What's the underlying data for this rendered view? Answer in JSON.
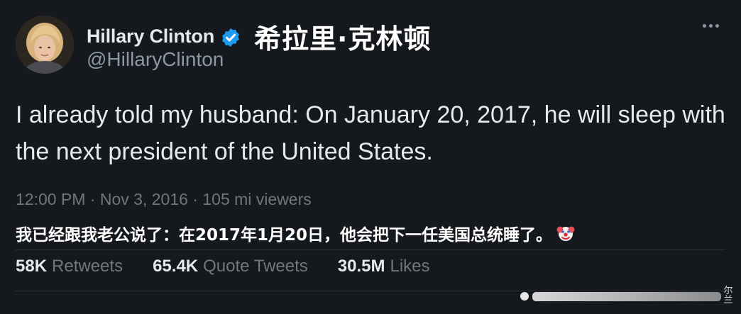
{
  "tweet": {
    "author": {
      "display_name": "Hillary Clinton",
      "chinese_name": "希拉里·克林顿",
      "handle": "@HillaryClinton",
      "verified": true,
      "avatar_icon": "profile-photo"
    },
    "more_icon": "more-options-icon",
    "text": "I already told my husband: On January 20, 2017, he will sleep with the next president of the United States.",
    "meta": "12:00 PM · Nov 3, 2016 · 105 mi viewers",
    "translation": "我已经跟我老公说了：在2017年1月20日，他会把下一任美国总统睡了。",
    "translation_emoji": "clown-face-icon"
  },
  "stats": [
    {
      "value": "58K",
      "label": "Retweets"
    },
    {
      "value": "65.4K",
      "label": "Quote Tweets"
    },
    {
      "value": "30.5M",
      "label": "Likes"
    }
  ],
  "colors": {
    "background": "#15181c",
    "text_primary": "#e7e9ea",
    "text_secondary": "#71767b",
    "verified_blue": "#1d9bf0"
  },
  "watermark_tag": "尔兰"
}
